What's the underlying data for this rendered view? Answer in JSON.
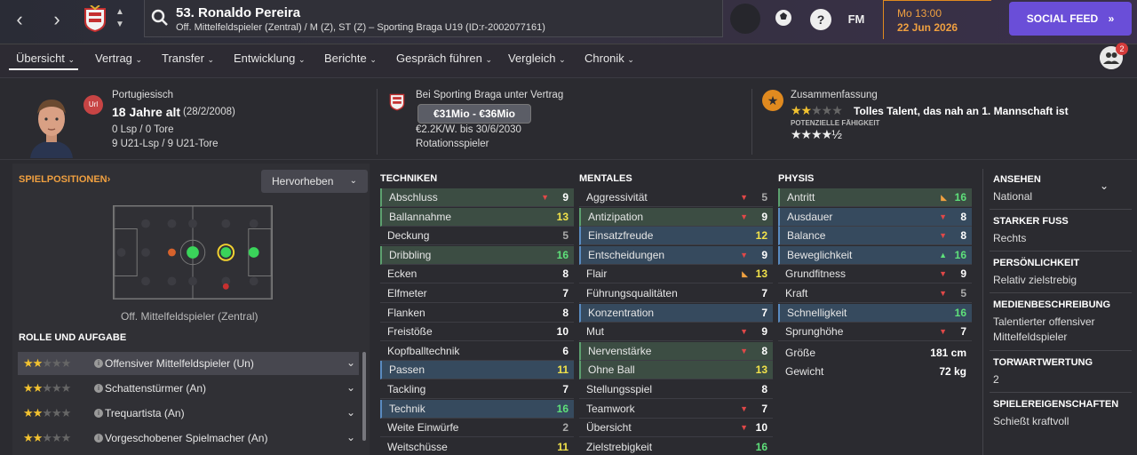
{
  "header": {
    "player_name": "53. Ronaldo Pereira",
    "player_subtitle": "Off. Mittelfeldspieler (Zentral) / M (Z), ST (Z) – Sporting Braga U19 (ID:r-2002077161)",
    "time": "Mo 13:00",
    "date": "22 Jun 2026",
    "social_feed": "SOCIAL FEED",
    "fm_label": "FM",
    "help_label": "?",
    "notif_count": "2"
  },
  "menu": [
    "Übersicht",
    "Vertrag",
    "Transfer",
    "Entwicklung",
    "Berichte",
    "Gespräch führen",
    "Vergleich",
    "Chronik"
  ],
  "info": {
    "u_badge": "Url",
    "nationality": "Portugiesisch",
    "age": "18 Jahre alt",
    "birth": "(28/2/2008)",
    "caps": "0 Lsp / 0 Tore",
    "u21": "9 U21-Lsp / 9 U21-Tore",
    "club_contract": "Bei Sporting Braga unter Vertrag",
    "value": "€31Mio - €36Mio",
    "wage": "€2.2K/W. bis 30/6/2030",
    "squad_status": "Rotationsspieler",
    "summary_title": "Zusammenfassung",
    "summary_text": "Tolles Talent, das nah an 1. Mannschaft ist",
    "potential_label": "POTENZIELLE FÄHIGKEIT",
    "current_stars": 2,
    "potential_stars": 4.5
  },
  "left": {
    "positions_title": "SPIELPOSITIONEN",
    "highlight_label": "Hervorheben",
    "pos_caption": "Off. Mittelfeldspieler (Zentral)",
    "roles_title": "ROLLE UND AUFGABE",
    "roles": [
      {
        "label": "Offensiver Mittelfeldspieler (Un)",
        "stars": 2
      },
      {
        "label": "Schattenstürmer (An)",
        "stars": 2
      },
      {
        "label": "Trequartista (An)",
        "stars": 2
      },
      {
        "label": "Vorgeschobener Spielmacher (An)",
        "stars": 2
      }
    ]
  },
  "columns": [
    {
      "title": "TECHNIKEN",
      "rows": [
        {
          "label": "Abschluss",
          "value": "9",
          "hl": "green",
          "arrow": "down"
        },
        {
          "label": "Ballannahme",
          "value": "13",
          "hl": "green",
          "arrow": ""
        },
        {
          "label": "Deckung",
          "value": "5",
          "hl": "",
          "arrow": ""
        },
        {
          "label": "Dribbling",
          "value": "16",
          "hl": "green",
          "arrow": ""
        },
        {
          "label": "Ecken",
          "value": "8",
          "hl": "",
          "arrow": ""
        },
        {
          "label": "Elfmeter",
          "value": "7",
          "hl": "",
          "arrow": ""
        },
        {
          "label": "Flanken",
          "value": "8",
          "hl": "",
          "arrow": ""
        },
        {
          "label": "Freistöße",
          "value": "10",
          "hl": "",
          "arrow": ""
        },
        {
          "label": "Kopfballtechnik",
          "value": "6",
          "hl": "",
          "arrow": ""
        },
        {
          "label": "Passen",
          "value": "11",
          "hl": "blue",
          "arrow": ""
        },
        {
          "label": "Tackling",
          "value": "7",
          "hl": "",
          "arrow": ""
        },
        {
          "label": "Technik",
          "value": "16",
          "hl": "blue",
          "arrow": ""
        },
        {
          "label": "Weite Einwürfe",
          "value": "2",
          "hl": "",
          "arrow": ""
        },
        {
          "label": "Weitschüsse",
          "value": "11",
          "hl": "",
          "arrow": ""
        }
      ]
    },
    {
      "title": "MENTALES",
      "rows": [
        {
          "label": "Aggressivität",
          "value": "5",
          "hl": "",
          "arrow": "down"
        },
        {
          "label": "Antizipation",
          "value": "9",
          "hl": "green",
          "arrow": "down"
        },
        {
          "label": "Einsatzfreude",
          "value": "12",
          "hl": "blue",
          "arrow": ""
        },
        {
          "label": "Entscheidungen",
          "value": "9",
          "hl": "blue",
          "arrow": "down"
        },
        {
          "label": "Flair",
          "value": "13",
          "hl": "",
          "arrow": "up-orange"
        },
        {
          "label": "Führungsqualitäten",
          "value": "7",
          "hl": "",
          "arrow": ""
        },
        {
          "label": "Konzentration",
          "value": "7",
          "hl": "blue",
          "arrow": ""
        },
        {
          "label": "Mut",
          "value": "9",
          "hl": "",
          "arrow": "down"
        },
        {
          "label": "Nervenstärke",
          "value": "8",
          "hl": "green",
          "arrow": "down"
        },
        {
          "label": "Ohne Ball",
          "value": "13",
          "hl": "green",
          "arrow": ""
        },
        {
          "label": "Stellungsspiel",
          "value": "8",
          "hl": "",
          "arrow": ""
        },
        {
          "label": "Teamwork",
          "value": "7",
          "hl": "",
          "arrow": "down"
        },
        {
          "label": "Übersicht",
          "value": "10",
          "hl": "",
          "arrow": "down"
        },
        {
          "label": "Zielstrebigkeit",
          "value": "16",
          "hl": "",
          "arrow": ""
        }
      ]
    },
    {
      "title": "PHYSIS",
      "rows": [
        {
          "label": "Antritt",
          "value": "16",
          "hl": "green",
          "arrow": "up-orange"
        },
        {
          "label": "Ausdauer",
          "value": "8",
          "hl": "blue",
          "arrow": "down"
        },
        {
          "label": "Balance",
          "value": "8",
          "hl": "blue",
          "arrow": "down"
        },
        {
          "label": "Beweglichkeit",
          "value": "16",
          "hl": "blue",
          "arrow": "up-green"
        },
        {
          "label": "Grundfitness",
          "value": "9",
          "hl": "",
          "arrow": "down"
        },
        {
          "label": "Kraft",
          "value": "5",
          "hl": "",
          "arrow": "down"
        },
        {
          "label": "Schnelligkeit",
          "value": "16",
          "hl": "blue",
          "arrow": ""
        },
        {
          "label": "Sprunghöhe",
          "value": "7",
          "hl": "",
          "arrow": "down"
        },
        {
          "label": "Größe",
          "value": "181 cm",
          "hl": "",
          "arrow": ""
        },
        {
          "label": "Gewicht",
          "value": "72 kg",
          "hl": "",
          "arrow": ""
        }
      ]
    }
  ],
  "right": [
    {
      "title": "ANSEHEN",
      "value": "National"
    },
    {
      "title": "STARKER FUSS",
      "value": "Rechts"
    },
    {
      "title": "PERSÖNLICHKEIT",
      "value": "Relativ zielstrebig"
    },
    {
      "title": "MEDIENBESCHREIBUNG",
      "value": "Talentierter offensiver Mittelfeldspieler"
    },
    {
      "title": "TORWARTWERTUNG",
      "value": "2"
    },
    {
      "title": "SPIELEREIGENSCHAFTEN",
      "value": "Schießt kraftvoll"
    }
  ],
  "colors": {
    "accent": "#f0a040",
    "social": "#6a4ed8",
    "green": "#5ee07a",
    "yellow": "#f2e24a",
    "red": "#e04848"
  }
}
